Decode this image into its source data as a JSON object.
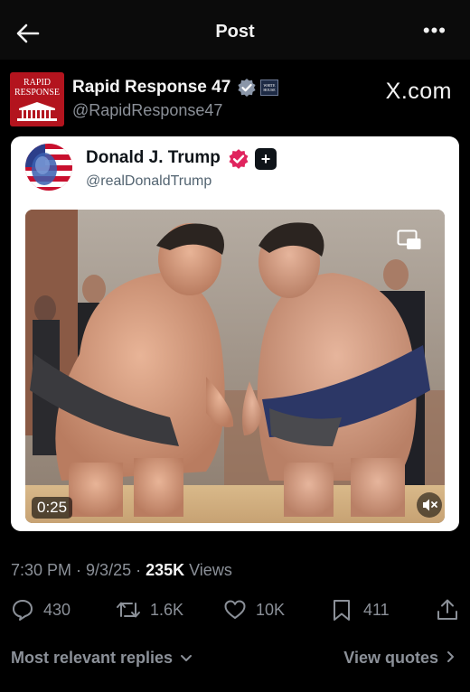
{
  "header": {
    "title": "Post",
    "back_icon": "arrow-left-icon",
    "more_icon": "more-horizontal-icon",
    "more_label": "•••"
  },
  "post": {
    "author_name": "Rapid Response 47",
    "author_handle": "@RapidResponse47",
    "avatar_text": "RAPID RESPONSE",
    "badge_text": "WHITE HOUSE",
    "source": "X.com",
    "verified_color": "#8a96a8"
  },
  "embedded": {
    "author_name": "Donald J. Trump",
    "author_handle": "@realDonaldTrump",
    "verified_color": "#e0245e",
    "badge_symbol": "+",
    "video_duration": "0:25"
  },
  "meta": {
    "time": "7:30 PM",
    "sep1": " · ",
    "date": "9/3/25",
    "sep2": " · ",
    "views_count": "235K",
    "views_label": " Views"
  },
  "actions": {
    "replies": "430",
    "reposts": "1.6K",
    "likes": "10K",
    "bookmarks": "411"
  },
  "footer": {
    "replies_filter": "Most relevant replies",
    "view_quotes": "View quotes"
  }
}
